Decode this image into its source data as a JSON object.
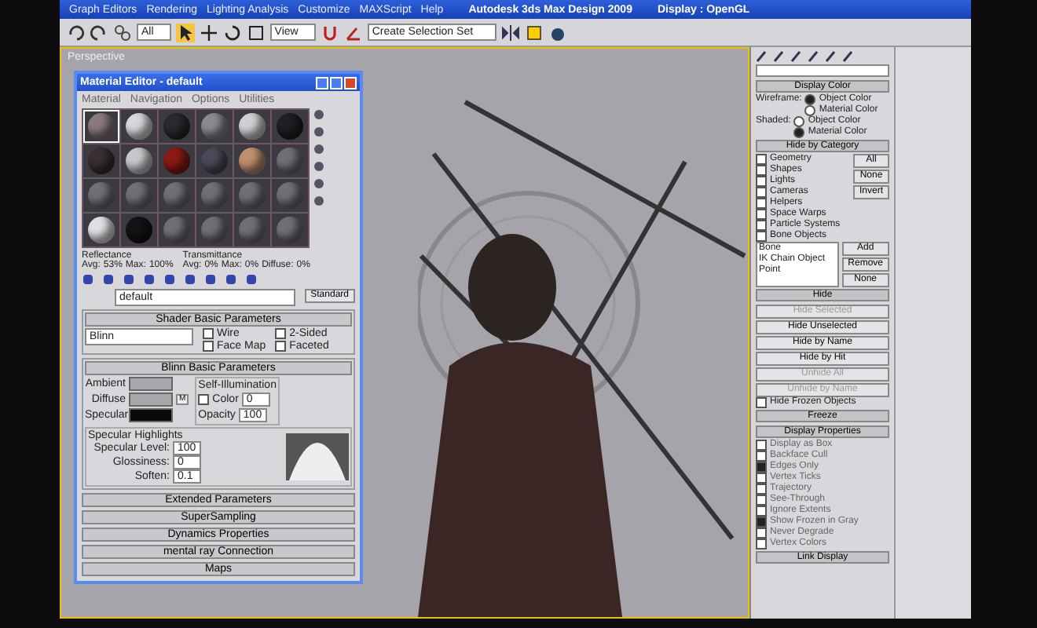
{
  "app": {
    "menu": [
      "Graph Editors",
      "Rendering",
      "Lighting Analysis",
      "Customize",
      "MAXScript",
      "Help"
    ],
    "title": "Autodesk 3ds Max Design 2009",
    "display": "Display : OpenGL"
  },
  "toolbar": {
    "filter": "All",
    "reference": "View",
    "selection_set": "Create Selection Set"
  },
  "viewport": {
    "label": "Perspective"
  },
  "material_editor": {
    "title": "Material Editor - default",
    "menu": [
      "Material",
      "Navigation",
      "Options",
      "Utilities"
    ],
    "slots": [
      {
        "color": "#8a7a7e",
        "selected": true
      },
      {
        "color": "#d8d8dc",
        "selected": false
      },
      {
        "color": "#2a2a2e",
        "selected": false
      },
      {
        "color": "#8a8a90",
        "selected": false
      },
      {
        "color": "#d0d0d4",
        "selected": false
      },
      {
        "color": "#202024",
        "selected": false
      },
      {
        "color": "#3a3030",
        "selected": false
      },
      {
        "color": "#c8c8cc",
        "selected": false
      },
      {
        "color": "#8a1a14",
        "selected": false
      },
      {
        "color": "#4a4a5a",
        "selected": false
      },
      {
        "color": "#c09070",
        "selected": false
      },
      {
        "color": "#707076",
        "selected": false
      },
      {
        "color": "#707076",
        "selected": false
      },
      {
        "color": "#707076",
        "selected": false
      },
      {
        "color": "#707076",
        "selected": false
      },
      {
        "color": "#707076",
        "selected": false
      },
      {
        "color": "#707076",
        "selected": false
      },
      {
        "color": "#707076",
        "selected": false
      },
      {
        "color": "#e0e0e4",
        "selected": false
      },
      {
        "color": "#141416",
        "selected": false
      },
      {
        "color": "#707076",
        "selected": false
      },
      {
        "color": "#707076",
        "selected": false
      },
      {
        "color": "#707076",
        "selected": false
      },
      {
        "color": "#707076",
        "selected": false
      }
    ],
    "reflectance": {
      "label": "Reflectance",
      "avg_label": "Avg:",
      "avg": "53%",
      "max_label": "Max:",
      "max": "100%"
    },
    "transmittance": {
      "label": "Transmittance",
      "avg_label": "Avg:",
      "avg": "0%",
      "max_label": "Max:",
      "max": "0%",
      "diffuse_label": "Diffuse:",
      "diffuse": "0%"
    },
    "name": "default",
    "type": "Standard",
    "shader": {
      "title": "Shader Basic Parameters",
      "shader": "Blinn",
      "options": [
        {
          "label": "Wire",
          "checked": false
        },
        {
          "label": "2-Sided",
          "checked": false
        },
        {
          "label": "Face Map",
          "checked": false
        },
        {
          "label": "Faceted",
          "checked": false
        }
      ]
    },
    "blinn": {
      "title": "Blinn Basic Parameters",
      "self_illum_title": "Self-Illumination",
      "color_label": "Color",
      "color_checked": false,
      "color_value": "0",
      "colors": [
        {
          "label": "Ambient",
          "color": "#a8a8ac"
        },
        {
          "label": "Diffuse",
          "color": "#a8a8ac"
        },
        {
          "label": "Specular",
          "color": "#0a0a0a"
        }
      ],
      "map_button": "M",
      "opacity_label": "Opacity",
      "opacity": "100"
    },
    "highlights": {
      "title": "Specular Highlights",
      "fields": [
        {
          "label": "Specular Level:",
          "value": "100"
        },
        {
          "label": "Glossiness:",
          "value": "0"
        },
        {
          "label": "Soften:",
          "value": "0.1"
        }
      ]
    },
    "rollouts": [
      "Extended Parameters",
      "SuperSampling",
      "Dynamics Properties",
      "mental ray Connection",
      "Maps"
    ]
  },
  "command_panel": {
    "display_color": {
      "title": "Display Color",
      "groups": [
        {
          "label": "Wireframe:",
          "options": [
            {
              "label": "Object Color",
              "selected": true
            },
            {
              "label": "Material Color",
              "selected": false
            }
          ]
        },
        {
          "label": "Shaded:",
          "options": [
            {
              "label": "Object Color",
              "selected": false
            },
            {
              "label": "Material Color",
              "selected": true
            }
          ]
        }
      ]
    },
    "hide_by_category": {
      "title": "Hide by Category",
      "categories": [
        {
          "label": "Geometry",
          "checked": false
        },
        {
          "label": "Shapes",
          "checked": false
        },
        {
          "label": "Lights",
          "checked": false
        },
        {
          "label": "Cameras",
          "checked": false
        },
        {
          "label": "Helpers",
          "checked": false
        },
        {
          "label": "Space Warps",
          "checked": false
        },
        {
          "label": "Particle Systems",
          "checked": false
        },
        {
          "label": "Bone Objects",
          "checked": false
        }
      ],
      "buttons": [
        "All",
        "None",
        "Invert"
      ],
      "list": [
        "Bone",
        "IK Chain Object",
        "Point"
      ],
      "list_buttons": [
        "Add",
        "Remove",
        "None"
      ]
    },
    "hide": {
      "title": "Hide",
      "buttons": [
        {
          "label": "Hide Selected",
          "disabled": true
        },
        {
          "label": "Hide Unselected",
          "disabled": false
        },
        {
          "label": "Hide by Name",
          "disabled": false
        },
        {
          "label": "Hide by Hit",
          "disabled": false
        },
        {
          "label": "Unhide All",
          "disabled": true
        },
        {
          "label": "Unhide by Name",
          "disabled": true
        }
      ],
      "hide_frozen": {
        "label": "Hide Frozen Objects",
        "checked": false
      }
    },
    "freeze": {
      "title": "Freeze"
    },
    "display_properties": {
      "title": "Display Properties",
      "options": [
        {
          "label": "Display as Box",
          "checked": false
        },
        {
          "label": "Backface Cull",
          "checked": false
        },
        {
          "label": "Edges Only",
          "checked": true
        },
        {
          "label": "Vertex Ticks",
          "checked": false
        },
        {
          "label": "Trajectory",
          "checked": false
        },
        {
          "label": "See-Through",
          "checked": false
        },
        {
          "label": "Ignore Extents",
          "checked": false
        },
        {
          "label": "Show Frozen in Gray",
          "checked": true
        },
        {
          "label": "Never Degrade",
          "checked": false
        },
        {
          "label": "Vertex Colors",
          "checked": false
        }
      ]
    },
    "link_display": {
      "title": "Link Display"
    }
  }
}
